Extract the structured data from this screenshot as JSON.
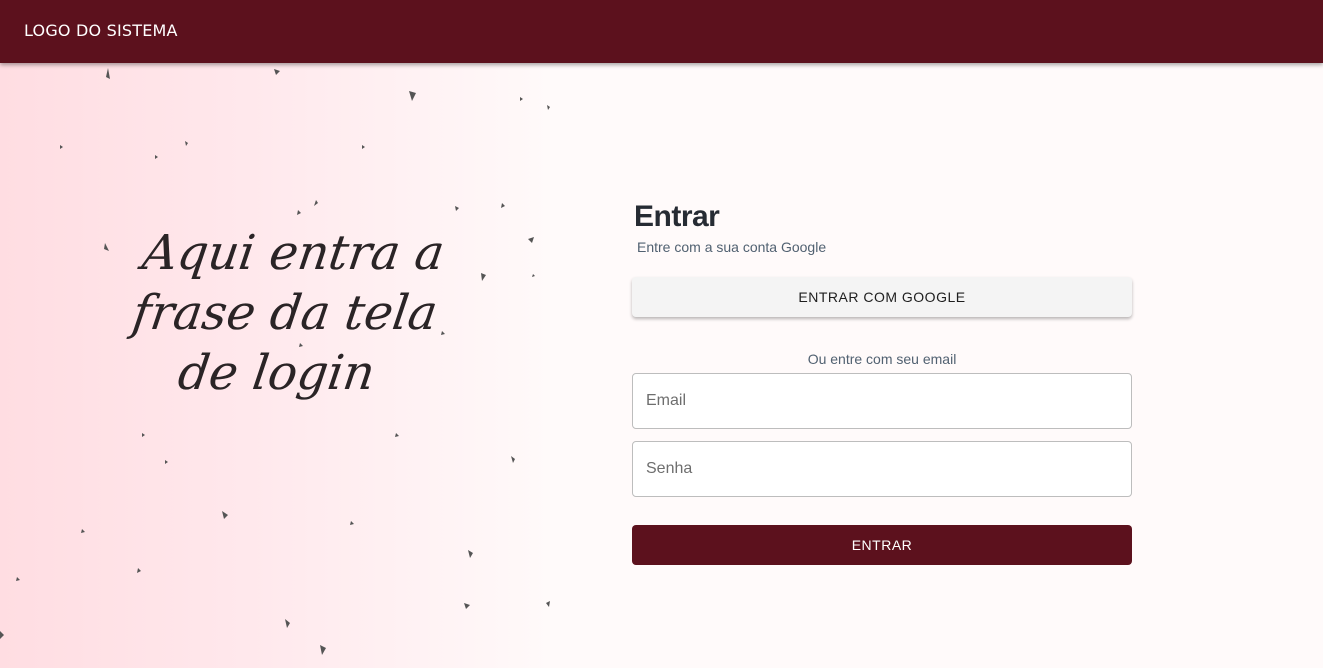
{
  "header": {
    "logo_text": "LOGO DO SISTEMA",
    "background_color": "#5c111d"
  },
  "hero": {
    "phrase": "Aqui entra a frase da tela de login"
  },
  "login_form": {
    "title": "Entrar",
    "subtitle": "Entre com a sua conta Google",
    "google_button_label": "ENTRAR COM GOOGLE",
    "alternative_text": "Ou entre com seu email",
    "email_placeholder": "Email",
    "password_placeholder": "Senha",
    "submit_label": "ENTRAR",
    "accent_color": "#5c111d"
  }
}
